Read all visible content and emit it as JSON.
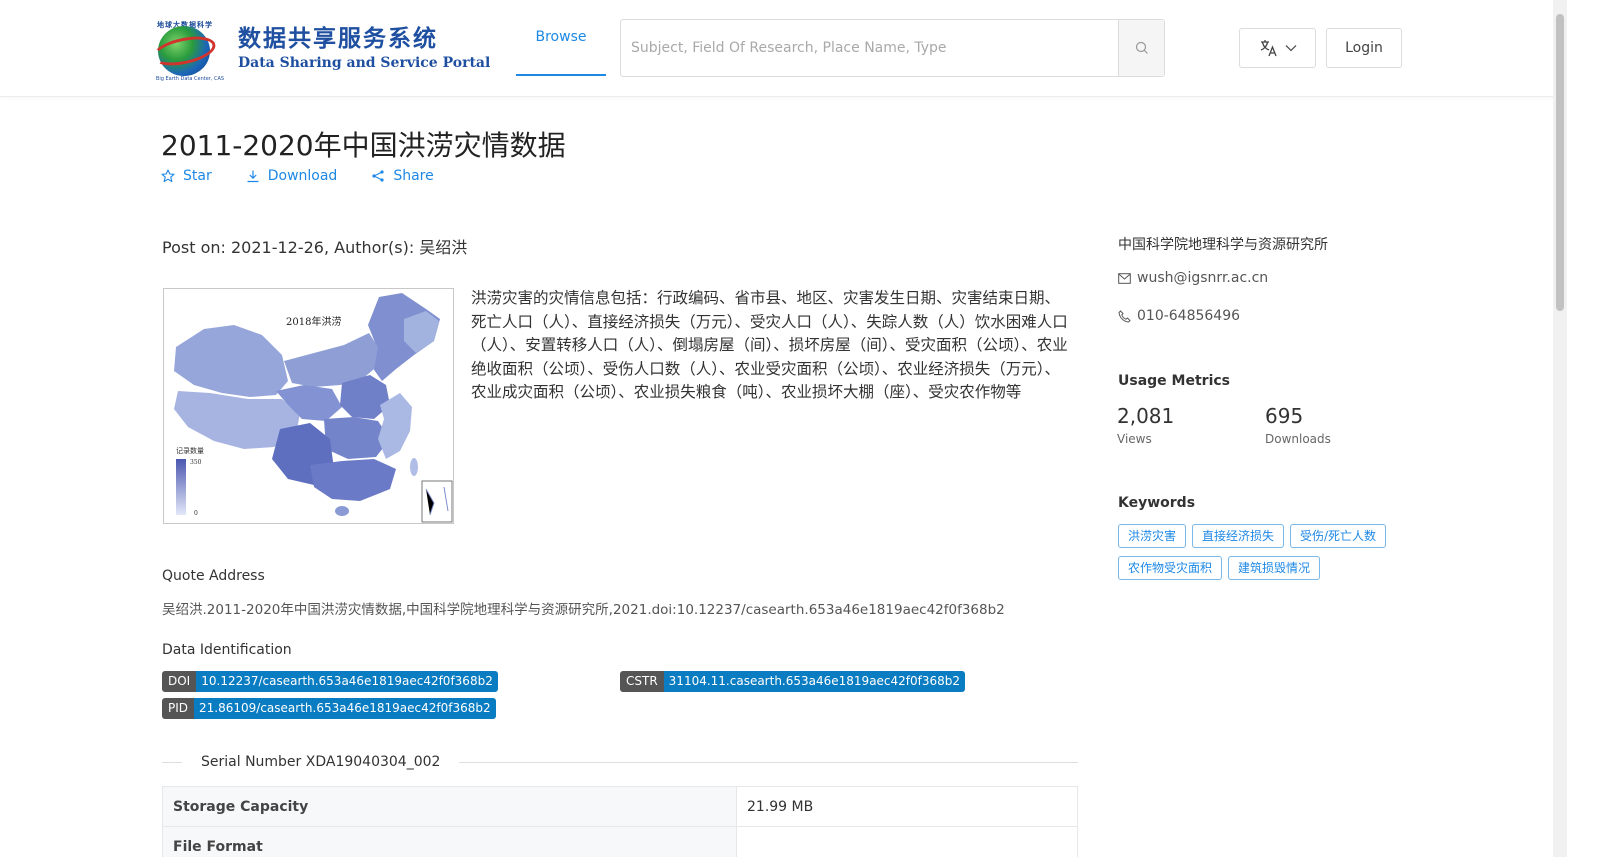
{
  "header": {
    "logo_cn": "数据共享服务系统",
    "logo_en": "Data Sharing and Service Portal",
    "logo_arc": "地球大数据科学数据中心",
    "logo_sub": "Big Earth Data Center, CAS",
    "nav_browse": "Browse",
    "search_placeholder": "Subject, Field Of Research, Place Name, Type",
    "login": "Login"
  },
  "dataset": {
    "title": "2011-2020年中国洪涝灾情数据",
    "actions": {
      "star": "Star",
      "download": "Download",
      "share": "Share"
    },
    "post_on": "Post on: 2021-12-26, Author(s): 吴绍洪",
    "thumbnail": {
      "map_title": "2018年洪涝",
      "legend_title": "记录数量",
      "legend_max": "350",
      "legend_min": "0"
    },
    "description": "洪涝灾害的灾情信息包括：行政编码、省市县、地区、灾害发生日期、灾害结束日期、死亡人口（人）、直接经济损失（万元）、受灾人口（人）、失踪人数（人）饮水困难人口（人）、安置转移人口（人）、倒塌房屋（间）、损坏房屋（间）、受灾面积（公顷）、农业绝收面积（公顷）、受伤人口数（人）、农业受灾面积（公顷）、农业经济损失（万元）、农业成灾面积（公顷）、农业损失粮食（吨）、农业损坏大棚（座）、受灾农作物等",
    "quote_label": "Quote Address",
    "quote_text": "吴绍洪.2011-2020年中国洪涝灾情数据,中国科学院地理科学与资源研究所,2021.doi:10.12237/casearth.653a46e1819aec42f0f368b2",
    "identification_label": "Data Identification",
    "identifiers": {
      "doi_key": "DOI",
      "doi_value": "10.12237/casearth.653a46e1819aec42f0f368b2",
      "cstr_key": "CSTR",
      "cstr_value": "31104.11.casearth.653a46e1819aec42f0f368b2",
      "pid_key": "PID",
      "pid_value": "21.86109/casearth.653a46e1819aec42f0f368b2"
    },
    "serial": "Serial Number XDA19040304_002",
    "table": [
      {
        "key": "Storage Capacity",
        "value": "21.99 MB"
      },
      {
        "key": "File Format",
        "value": ""
      }
    ]
  },
  "sidebar": {
    "institution": "中国科学院地理科学与资源研究所",
    "email": "wush@igsnrr.ac.cn",
    "phone": "010-64856496",
    "usage_heading": "Usage Metrics",
    "views_count": "2,081",
    "views_label": "Views",
    "downloads_count": "695",
    "downloads_label": "Downloads",
    "keywords_heading": "Keywords",
    "keywords": [
      "洪涝灾害",
      "直接经济损失",
      "受伤/死亡人数",
      "农作物受灾面积",
      "建筑损毁情况"
    ]
  },
  "colors": {
    "accent": "#1e88e5",
    "badge_key": "#555555",
    "badge_value": "#0a7cc1"
  }
}
